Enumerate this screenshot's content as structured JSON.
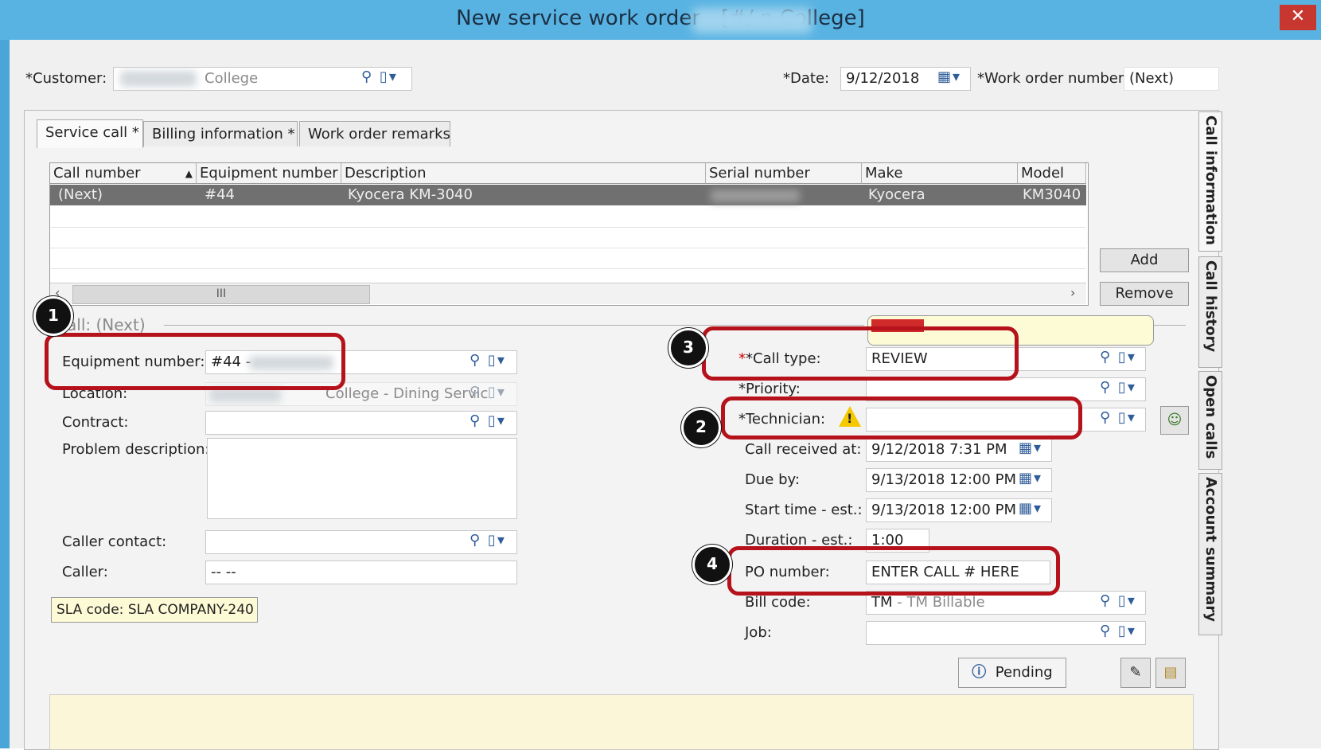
{
  "window": {
    "title": "New service work order - [#/                n College]",
    "close_glyph": "✕"
  },
  "header": {
    "customer_label": "*Customer:",
    "customer_value": "College",
    "date_label": "*Date:",
    "date_value": "9/12/2018",
    "wo_number_label": "*Work order number:",
    "wo_number_value": "(Next)"
  },
  "tabs": [
    {
      "label": "Service call *"
    },
    {
      "label": "Billing information  *"
    },
    {
      "label": "Work order remarks"
    }
  ],
  "grid": {
    "columns": [
      "Call number",
      "Equipment number",
      "Description",
      "Serial number",
      "Make",
      "Model"
    ],
    "rows": [
      {
        "call_number": "(Next)",
        "equipment_number": "#44",
        "description": "Kyocera KM-3040",
        "make": "Kyocera",
        "model": "KM3040"
      }
    ],
    "scroll_thumb": "III"
  },
  "buttons": {
    "add": "Add",
    "remove": "Remove",
    "pending": "Pending"
  },
  "call_section": {
    "header": "all: (Next)"
  },
  "left_form": {
    "equipment_label": "Equipment number:",
    "equipment_value": "#44 -",
    "location_label": "Location:",
    "location_value": "College - Dining Servic",
    "contract_label": "Contract:",
    "problem_label": "Problem description:",
    "caller_contact_label": "Caller contact:",
    "caller_label": "Caller:",
    "caller_value": "-- --",
    "sla": "SLA code: SLA COMPANY-240"
  },
  "right_form": {
    "call_type_label": "*Call type:",
    "call_type_value": "REVIEW",
    "priority_label": "*Priority:",
    "technician_label": "*Technician:",
    "call_received_label": "Call received at:",
    "call_received_value": "9/12/2018   7:31 PM",
    "due_by_label": "Due by:",
    "due_by_value": "9/13/2018 12:00 PM",
    "start_time_label": "Start time - est.:",
    "start_time_value": "9/13/2018 12:00 PM",
    "duration_label": "Duration - est.:",
    "duration_value": "1:00",
    "po_label": "PO number:",
    "po_value": "ENTER CALL # HERE",
    "bill_code_label": "Bill code:",
    "bill_code_value": "TM",
    "bill_code_desc": "- TM Billable",
    "job_label": "Job:"
  },
  "side_tabs": [
    "Call information",
    "Call history",
    "Open calls",
    "Account summary"
  ],
  "callouts": [
    "1",
    "2",
    "3",
    "4"
  ],
  "colors": {
    "title_bar": "#59b3e2",
    "callout_red": "#b5121b",
    "selected_row": "#707070",
    "sla_bg": "#fdfbd6"
  }
}
